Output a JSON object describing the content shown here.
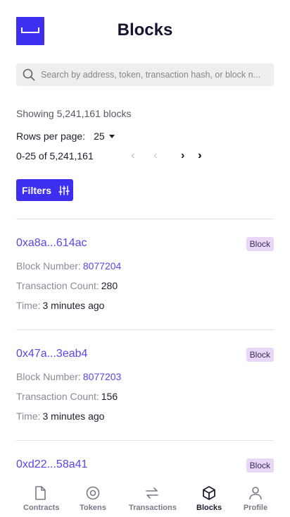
{
  "header": {
    "title": "Blocks"
  },
  "search": {
    "placeholder": "Search by address, token, transaction hash, or block n..."
  },
  "summary": {
    "showing": "Showing 5,241,161 blocks"
  },
  "pagination": {
    "rows_label": "Rows per page:",
    "rows_value": "25",
    "range": "0-25 of 5,241,161",
    "first": "«",
    "prev": "‹",
    "next": "›",
    "last": "»"
  },
  "filters": {
    "label": "Filters"
  },
  "blocks": [
    {
      "hash": "0xa8a...614ac",
      "badge": "Block",
      "number_label": "Block Number:",
      "number": "8077204",
      "tx_label": "Transaction Count:",
      "tx_count": "280",
      "time_label": "Time:",
      "time": "3 minutes ago"
    },
    {
      "hash": "0x47a...3eab4",
      "badge": "Block",
      "number_label": "Block Number:",
      "number": "8077203",
      "tx_label": "Transaction Count:",
      "tx_count": "156",
      "time_label": "Time:",
      "time": "3 minutes ago"
    },
    {
      "hash": "0xd22...58a41",
      "badge": "Block"
    }
  ],
  "nav": {
    "items": [
      {
        "label": "Contracts",
        "icon": "file-icon"
      },
      {
        "label": "Tokens",
        "icon": "token-icon"
      },
      {
        "label": "Transactions",
        "icon": "transfer-icon"
      },
      {
        "label": "Blocks",
        "icon": "cube-icon",
        "active": true
      },
      {
        "label": "Profile",
        "icon": "user-icon"
      }
    ]
  },
  "colors": {
    "accent": "#3d2ef0",
    "link": "#5a45ec",
    "badge_bg": "#e8d8f6"
  }
}
